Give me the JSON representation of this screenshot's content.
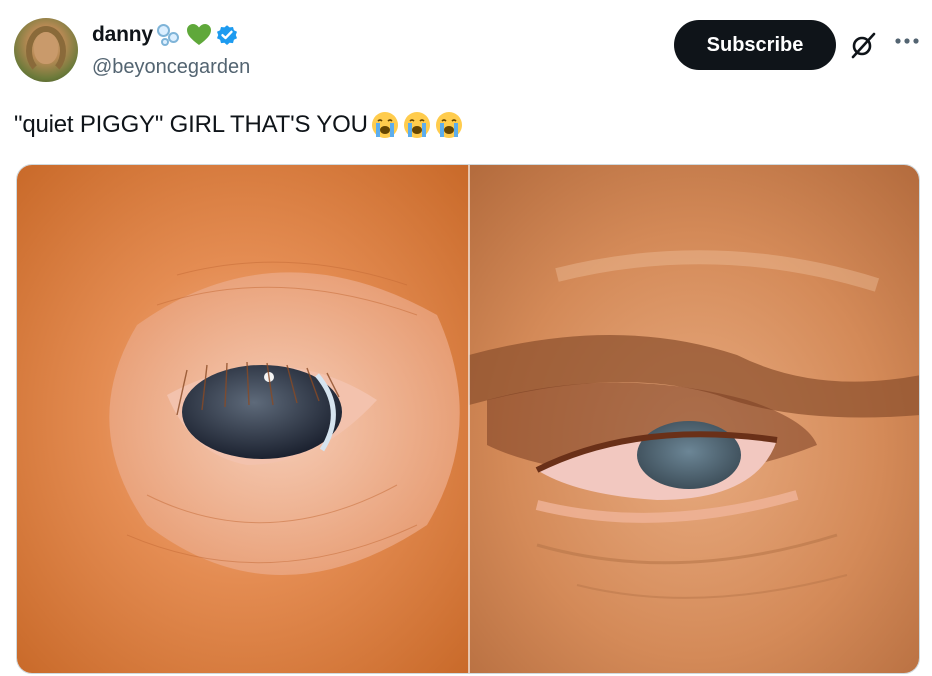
{
  "user": {
    "display_name": "danny",
    "handle": "@beyoncegarden",
    "name_emojis": [
      "bubbles-icon",
      "green-heart-icon"
    ],
    "verified": true
  },
  "actions": {
    "subscribe_label": "Subscribe",
    "grok_icon": "grok-icon",
    "more_icon": "more-icon"
  },
  "tweet": {
    "text": "\"quiet PIGGY\" GIRL THAT'S YOU",
    "emojis": [
      "loudly-crying-face",
      "loudly-crying-face",
      "loudly-crying-face"
    ]
  },
  "media": {
    "panels": [
      "pig-eye-closeup",
      "human-eye-closeup"
    ]
  },
  "colors": {
    "accent": "#1d9bf0",
    "text_primary": "#0f1419",
    "text_secondary": "#536471",
    "button_bg": "#0f1419"
  }
}
